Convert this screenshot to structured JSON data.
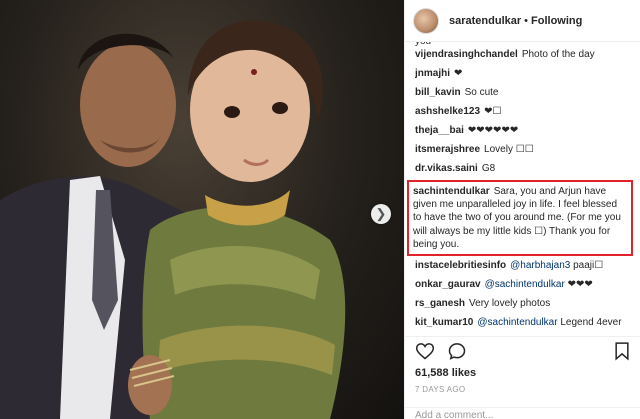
{
  "header": {
    "username": "saratendulkar",
    "separator": "•",
    "follow_status": "Following"
  },
  "comments": {
    "clipped_top": "you",
    "items": [
      {
        "user": "vijendrasinghchandel",
        "text": "Photo of the day"
      },
      {
        "user": "jnmajhi",
        "text": "❤"
      },
      {
        "user": "bill_kavin",
        "text": "So cute"
      },
      {
        "user": "ashshelke123",
        "text": "❤☐"
      },
      {
        "user": "theja__bai",
        "text": "❤❤❤❤❤❤"
      },
      {
        "user": "itsmerajshree",
        "text": "Lovely ☐☐"
      },
      {
        "user": "dr.vikas.saini",
        "text": "G8"
      }
    ],
    "highlighted": {
      "user": "sachintendulkar",
      "text": "Sara, you and Arjun have given me unparalleled joy in life. I feel blessed to have the two of you around me. (For me you will always be my little kids ☐) Thank you for being you."
    },
    "after": [
      {
        "user": "instacelebritiesinfo",
        "mention": "@harbhajan3",
        "text": "paaji☐"
      },
      {
        "user": "onkar_gaurav",
        "mention": "@sachintendulkar",
        "text": "❤❤❤"
      },
      {
        "user": "rs_ganesh",
        "mention": "",
        "text": "Very lovely photos"
      },
      {
        "user": "kit_kumar10",
        "mention": "@sachintendulkar",
        "text": "Legend 4ever"
      }
    ]
  },
  "actions": {
    "likes": "61,588 likes",
    "age": "7 DAYS AGO",
    "add_comment_placeholder": "Add a comment..."
  },
  "colors": {
    "highlight_border": "#e0232b",
    "mention": "#003569"
  },
  "icons": [
    "heart-icon",
    "comment-icon",
    "share-icon",
    "bookmark-icon",
    "chevron-right-icon"
  ]
}
